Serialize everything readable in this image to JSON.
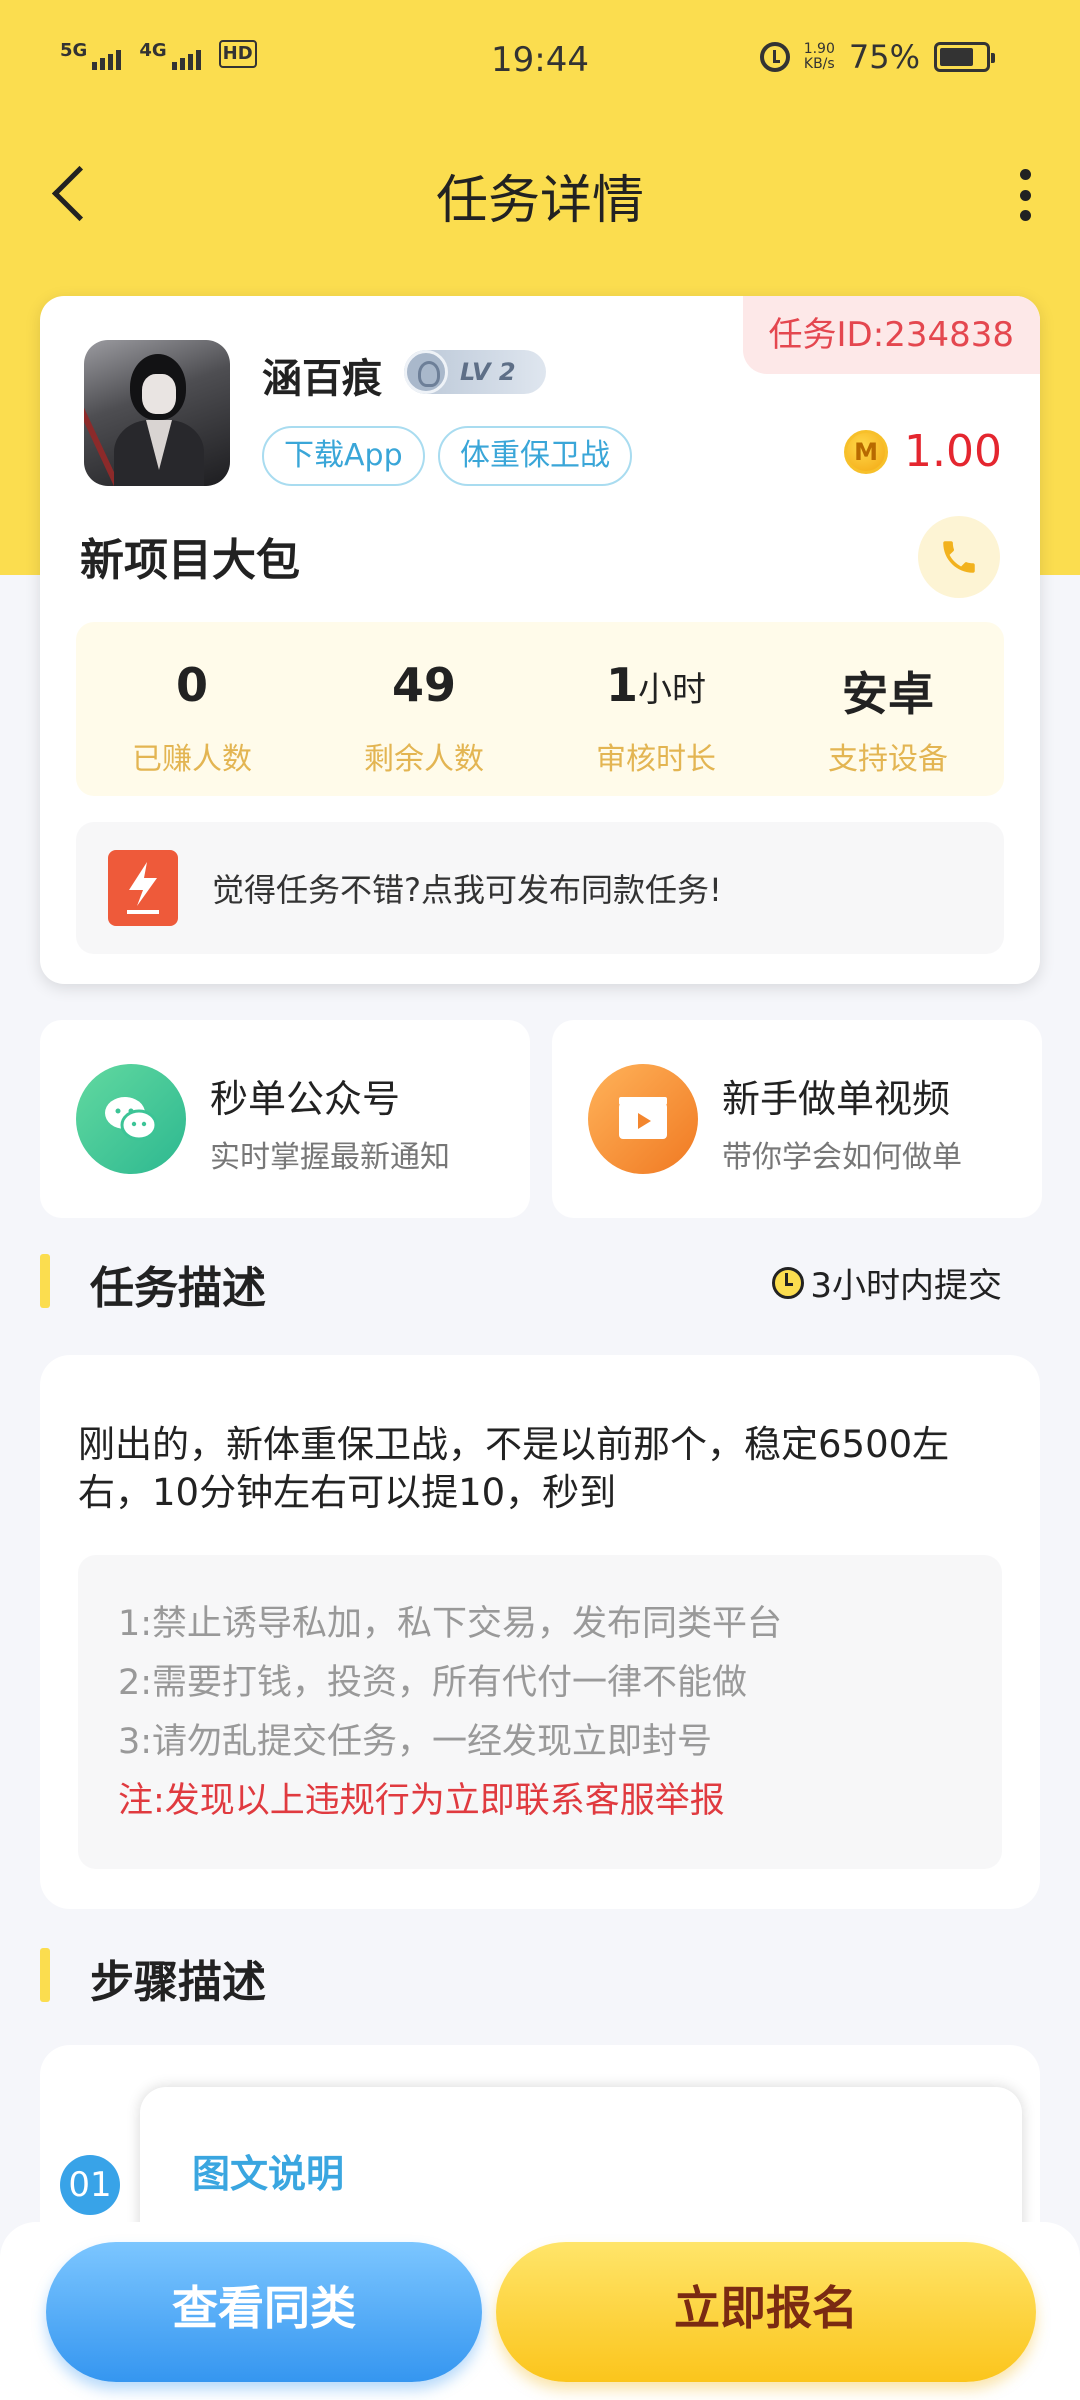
{
  "status_bar": {
    "signal1_label": "5G",
    "signal2_label": "4G",
    "hd_label": "HD",
    "time": "19:44",
    "speed_value": "1.90",
    "speed_unit": "KB/s",
    "battery": "75%",
    "battery_level": 0.75,
    "icons": [
      "signal-icon",
      "alarm-icon",
      "battery-icon"
    ]
  },
  "header": {
    "title": "任务详情",
    "back_icon": "chevron-left-icon",
    "more_icon": "more-vertical-icon"
  },
  "task": {
    "id_label": "任务ID:234838",
    "user_name": "涵百痕",
    "level": "LV 2",
    "tags": [
      "下载App",
      "体重保卫战"
    ],
    "reward": "1.00",
    "coin_symbol": "M",
    "project_name": "新项目大包",
    "stats": [
      {
        "value": "0",
        "unit": "",
        "label": "已赚人数"
      },
      {
        "value": "49",
        "unit": "",
        "label": "剩余人数"
      },
      {
        "value": "1",
        "unit": "小时",
        "label": "审核时长"
      },
      {
        "value": "安卓",
        "unit": "",
        "label": "支持设备"
      }
    ],
    "publish_text": "觉得任务不错?点我可发布同款任务!"
  },
  "quick": [
    {
      "title": "秒单公众号",
      "subtitle": "实时掌握最新通知",
      "icon": "wechat-icon"
    },
    {
      "title": "新手做单视频",
      "subtitle": "带你学会如何做单",
      "icon": "video-icon"
    }
  ],
  "description": {
    "section_title": "任务描述",
    "deadline": "3小时内提交",
    "text": "刚出的，新体重保卫战，不是以前那个，稳定6500左右，10分钟左右可以提10，秒到",
    "rules": [
      "1:禁止诱导私加，私下交易，发布同类平台",
      "2:需要打钱，投资，所有代付一律不能做",
      "3:请勿乱提交任务，一经发现立即封号"
    ],
    "warning": "注:发现以上违规行为立即联系客服举报"
  },
  "steps": {
    "section_title": "步骤描述",
    "first_step_number": "01",
    "first_step_title": "图文说明"
  },
  "bottom": {
    "similar_label": "查看同类",
    "signup_label": "立即报名"
  },
  "colors": {
    "header_bg": "#fbdd4f",
    "reward": "#e4262f",
    "link_blue": "#3aa6d8",
    "warning_red": "#e03a3f"
  }
}
